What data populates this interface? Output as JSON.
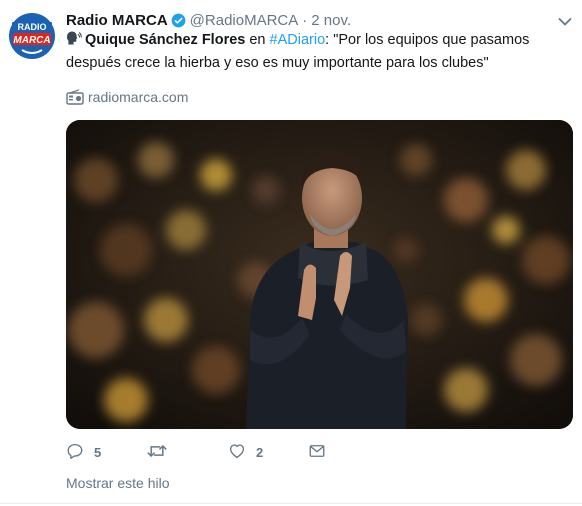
{
  "tweet": {
    "author_name": "Radio MARCA",
    "author_handle": "@RadioMARCA",
    "separator": "·",
    "time": "2 nov.",
    "avatar": {
      "line1": "RADIO",
      "line2": "MARCA",
      "colors": {
        "bg": "#1b62b4",
        "badge": "#e1251b"
      }
    },
    "body": {
      "emoji": "speaking-head-icon",
      "person": "Quique Sánchez Flores",
      "connector": " en ",
      "hashtag": "#ADiario",
      "quote": ": \"Por los equipos que pasamos después crece la hierba y eso es muy importante para los clubes\""
    },
    "link": {
      "icon": "radio-icon",
      "domain": "radiomarca.com"
    },
    "actions": {
      "reply": {
        "icon": "reply-icon",
        "count": "5"
      },
      "retweet": {
        "icon": "retweet-icon",
        "count": ""
      },
      "like": {
        "icon": "heart-icon",
        "count": "2"
      },
      "dm": {
        "icon": "envelope-icon"
      }
    },
    "show_thread": "Mostrar este hilo",
    "colors": {
      "accent": "#1da1f2",
      "muted": "#657786",
      "text": "#14171a"
    }
  }
}
